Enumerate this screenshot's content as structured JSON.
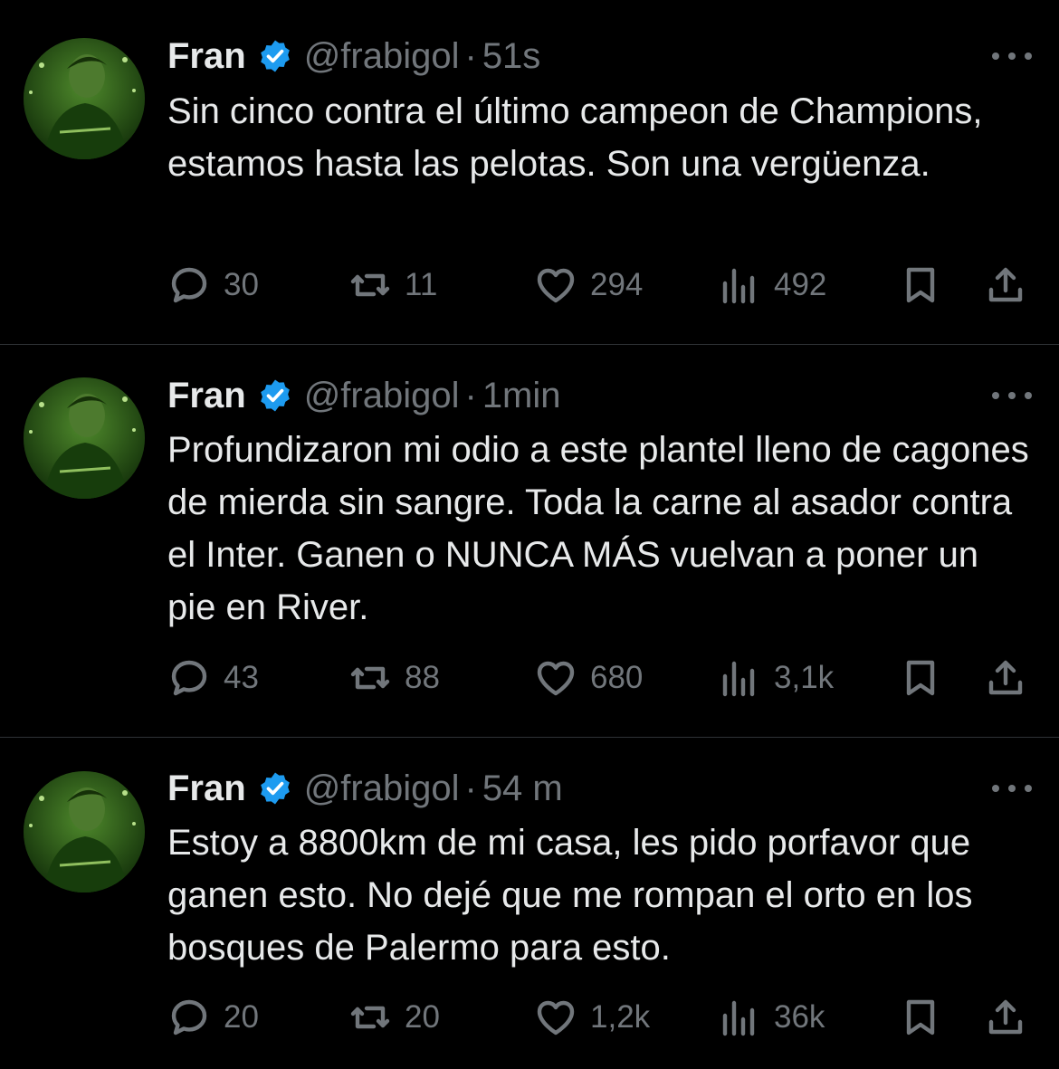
{
  "tweets": [
    {
      "author": "Fran",
      "handle": "@frabigol",
      "separator": "·",
      "time": "51s",
      "text": "Sin cinco contra el último campeon de Champions, estamos hasta las pelotas. Son una vergüenza.",
      "replies": "30",
      "retweets": "11",
      "likes": "294",
      "views": "492"
    },
    {
      "author": "Fran",
      "handle": "@frabigol",
      "separator": "·",
      "time": "1min",
      "text": "Profundizaron mi odio a este plantel lleno de cagones de mierda sin sangre. Toda la carne al asador contra el Inter. Ganen o NUNCA MÁS vuelvan a poner un pie en River.",
      "replies": "43",
      "retweets": "88",
      "likes": "680",
      "views": "3,1k"
    },
    {
      "author": "Fran",
      "handle": "@frabigol",
      "separator": "·",
      "time": "54 m",
      "text": "Estoy a 8800km de mi casa, les pido porfavor que ganen esto. No dejé que me rompan el orto en los bosques de Palermo para esto.",
      "replies": "20",
      "retweets": "20",
      "likes": "1,2k",
      "views": "36k"
    }
  ],
  "icons": {
    "verified": "verified-badge-icon",
    "reply": "reply-icon",
    "retweet": "retweet-icon",
    "like": "heart-icon",
    "views": "views-icon",
    "bookmark": "bookmark-icon",
    "share": "share-icon",
    "more": "more-icon"
  },
  "colors": {
    "background": "#000000",
    "text": "#e7e9ea",
    "secondary": "#71767b",
    "verified": "#1d9bf0",
    "divider": "#2f3336"
  }
}
